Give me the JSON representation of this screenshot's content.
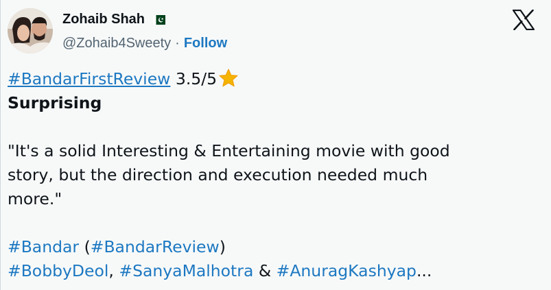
{
  "author": {
    "display_name": "Zohaib Shah",
    "handle": "@Zohaib4Sweety",
    "separator": "·",
    "follow_label": "Follow"
  },
  "tweet": {
    "hashtag_review": "#BandarFirstReview",
    "rating": "3.5/5",
    "headline": "Surprising",
    "quote_line1": "\"It's a solid Interesting & Entertaining movie with good",
    "quote_line2": "story, but the direction and execution needed much",
    "quote_line3": "more.\"",
    "tag_bandar": "#Bandar",
    "paren_open": "(",
    "tag_bandar_review": "#BandarReview",
    "paren_close": ")",
    "tag_bobby": "#BobbyDeol",
    "comma": ",",
    "tag_sanya": "#SanyaMalhotra",
    "ampersand": "&",
    "tag_anurag": "#AnuragKashyap",
    "ellipsis": "..."
  },
  "colors": {
    "link": "#1d78c1",
    "text": "#0f1419",
    "muted": "#536471",
    "background": "#f7f9f9",
    "star": "#f4b400",
    "flag_green": "#01411c"
  },
  "icons": {
    "platform": "x-logo-icon",
    "rating": "star-icon",
    "flag": "pakistan-flag-icon"
  }
}
